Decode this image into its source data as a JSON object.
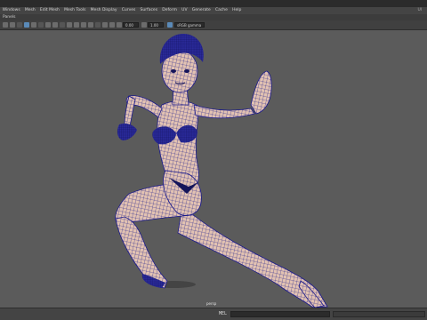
{
  "menubar": {
    "items": [
      "Windows",
      "Mesh",
      "Edit Mesh",
      "Mesh Tools",
      "Mesh Display",
      "Curves",
      "Surfaces",
      "Deform",
      "UV",
      "Generate",
      "Cache",
      "Help"
    ],
    "user": "Ul"
  },
  "panels_menu": {
    "label": "Panels"
  },
  "toolbar": {
    "field_a": "0.00",
    "field_b": "1.00",
    "colorspace": "sRGB gamma"
  },
  "viewport": {
    "camera_label": "persp",
    "mesh_color": "#1a1a8c",
    "skin_color": "#e2c2b2",
    "background": "#5b5b5b"
  },
  "statusbar": {
    "script_mode": "MEL"
  },
  "colors": {
    "menubar": "#444444",
    "toolbar": "#404040",
    "accent": "#5a8ab8"
  }
}
